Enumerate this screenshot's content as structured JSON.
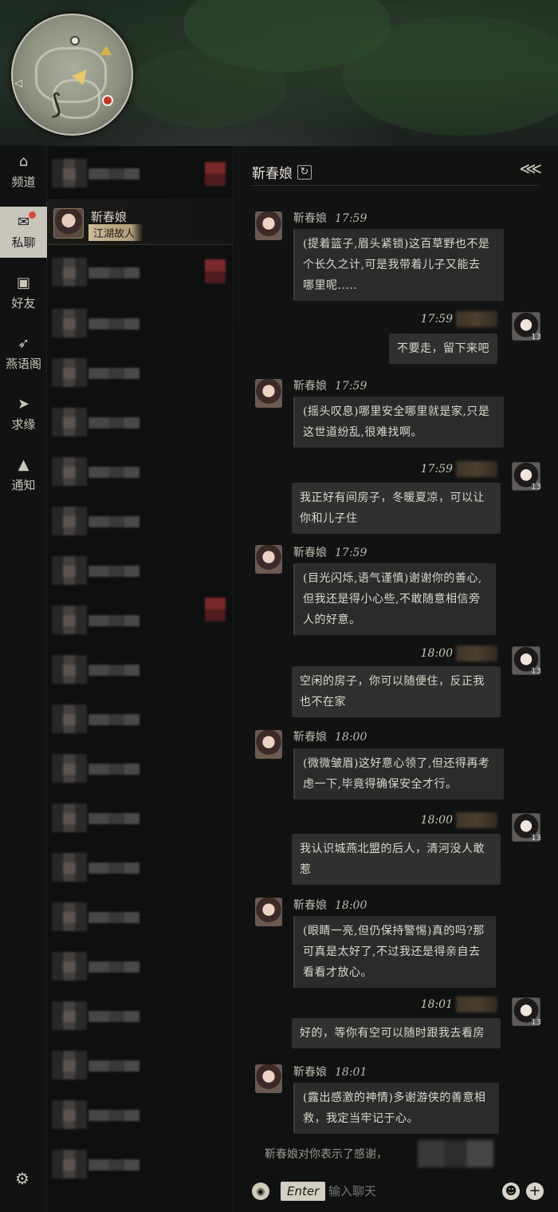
{
  "nav": {
    "items": [
      {
        "label": "频道",
        "icon": "home-icon"
      },
      {
        "label": "私聊",
        "icon": "chat-bubble-icon"
      },
      {
        "label": "好友",
        "icon": "contact-card-icon"
      },
      {
        "label": "燕语阁",
        "icon": "swallow-icon"
      },
      {
        "label": "求缘",
        "icon": "paper-plane-icon"
      },
      {
        "label": "通知",
        "icon": "bell-icon"
      }
    ],
    "settings_icon": "gear-icon"
  },
  "contacts": {
    "active": {
      "name": "靳春娘",
      "tag": "江湖故人"
    }
  },
  "chat": {
    "title": "靳春娘",
    "partner_name": "靳春娘",
    "messages": [
      {
        "from": "them",
        "time": "17:59",
        "text": [
          "(提着篮子,眉头紧锁)这百草野也不是",
          "个长久之计,可是我带着儿子又能去",
          "哪里呢....."
        ]
      },
      {
        "from": "me",
        "time": "17:59",
        "text": [
          "不要走，留下来吧"
        ],
        "level": "13"
      },
      {
        "from": "them",
        "time": "17:59",
        "text": [
          "(摇头叹息)哪里安全哪里就是家,只是",
          "这世道纷乱,很难找啊。"
        ]
      },
      {
        "from": "me",
        "time": "17:59",
        "text": [
          "我正好有间房子，冬暖夏凉，可以让",
          "你和儿子住"
        ],
        "level": "13"
      },
      {
        "from": "them",
        "time": "17:59",
        "text": [
          "(目光闪烁,语气谨慎)谢谢你的善心,",
          "但我还是得小心些,不敢随意相信旁",
          "人的好意。"
        ]
      },
      {
        "from": "me",
        "time": "18:00",
        "text": [
          "空闲的房子，你可以随便住，反正我",
          "也不在家"
        ],
        "level": "13"
      },
      {
        "from": "them",
        "time": "18:00",
        "text": [
          "(微微皱眉)这好意心领了,但还得再考",
          "虑一下,毕竟得确保安全才行。"
        ]
      },
      {
        "from": "me",
        "time": "18:00",
        "text": [
          "我认识城燕北盟的后人，清河没人敢",
          "惹"
        ],
        "level": "13"
      },
      {
        "from": "them",
        "time": "18:00",
        "text": [
          "(眼睛一亮,但仍保持警惕)真的吗?那",
          "可真是太好了,不过我还是得亲自去",
          "看看才放心。"
        ]
      },
      {
        "from": "me",
        "time": "18:01",
        "text": [
          "好的，等你有空可以随时跟我去看房"
        ],
        "level": "13"
      },
      {
        "from": "them",
        "time": "18:01",
        "text": [
          "(露出感激的神情)多谢游侠的善意相",
          "救，我定当牢记于心。"
        ]
      }
    ],
    "system_message": "靳春娘对你表示了感谢，",
    "input": {
      "enter_label": "Enter",
      "placeholder": "输入聊天"
    }
  },
  "colors": {
    "accent_tag": "#cbb997",
    "badge_red": "#e0463e",
    "bubble_bg": "#2a2b2b"
  }
}
